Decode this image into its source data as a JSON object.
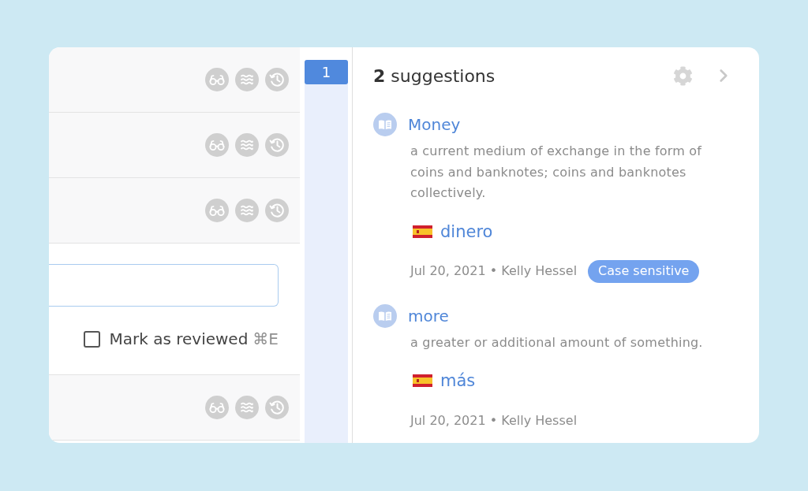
{
  "segments": [
    {
      "kind": "segment"
    },
    {
      "kind": "segment"
    },
    {
      "kind": "segment"
    },
    {
      "kind": "editor",
      "checkbox": {
        "label": "Mark as reviewed",
        "shortcut": "⌘E",
        "checked": false
      }
    },
    {
      "kind": "segment"
    }
  ],
  "segment_number": "1",
  "suggestions_panel": {
    "count": "2",
    "title": "suggestions",
    "items": [
      {
        "term": "Money",
        "definition": "a current medium of exchange in the form of coins and banknotes; coins and banknotes collectively.",
        "translation": "dinero",
        "byline": "Jul 20, 2021 • Kelly Hessel",
        "tags": [
          "Case sensitive"
        ]
      },
      {
        "term": "more",
        "definition": "a greater or additional amount of something.",
        "translation": "más",
        "byline": "Jul 20, 2021 • Kelly Hessel"
      }
    ]
  }
}
